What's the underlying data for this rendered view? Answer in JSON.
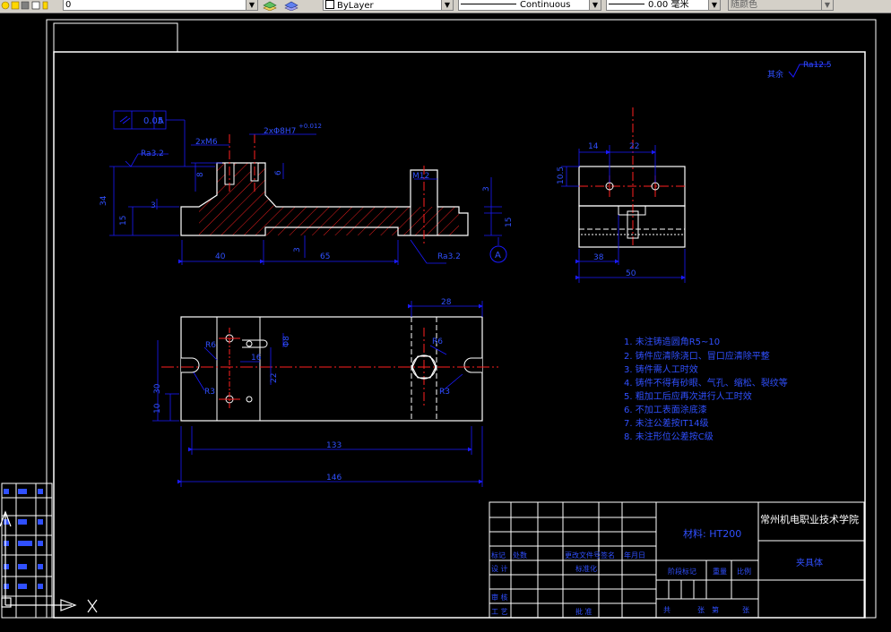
{
  "toolbar": {
    "layer_value": "0",
    "color_value": "ByLayer",
    "linetype_value": "Continuous",
    "lineweight_value": "0.00 毫米",
    "plotstyle_value": "随颜色"
  },
  "drawing": {
    "roughness_global": "其余",
    "roughness_global_value": "Ra12.5",
    "parallelism_tolerance": "0.05",
    "parallelism_datum": "A",
    "thread_label": "2xM6",
    "hole_label": "2xΦ8H7",
    "hole_tol": "+0.012",
    "ra_side": "Ra3.2",
    "ra_bottom": "Ra3.2",
    "m12": "M12",
    "datum_a": "A",
    "dim_34": "34",
    "dim_15_left": "15",
    "dim_3_left": "3",
    "dim_8": "8",
    "dim_6": "6",
    "dim_40": "40",
    "dim_65": "65",
    "dim_3_mid": "3",
    "dim_3_right": "3",
    "dim_15_right": "15",
    "dim_14": "14",
    "dim_22_side": "22",
    "dim_10_5": "10.5",
    "dim_38": "38",
    "dim_50": "50",
    "dim_28": "28",
    "dim_30": "30",
    "dim_10": "10",
    "dim_22_plan": "22",
    "dim_16": "16",
    "dim_phi8": "Φ8",
    "dim_r6_left": "R6",
    "dim_r3_left": "R3",
    "dim_r6_right": "R6",
    "dim_r3_right": "R3",
    "dim_133": "133",
    "dim_146": "146"
  },
  "notes": [
    "1. 未注铸造圆角R5~10",
    "2. 铸件应清除浇口、冒口应清除平整",
    "3. 铸件需人工时效",
    "4. 铸件不得有砂眼、气孔、缩松、裂纹等",
    "5. 粗加工后应再次进行人工时效",
    "6. 不加工表面涂底漆",
    "7. 未注公差按IT14级",
    "8. 未注形位公差按C级"
  ],
  "title_block": {
    "school": "常州机电职业技术学院",
    "material": "材料: HT200",
    "part_name": "夹具体",
    "row_design": "设 计",
    "row_standard": "标准化",
    "row_review": "审 核",
    "row_process": "工 艺",
    "row_approve": "批 准",
    "stage_mark": "阶段标记",
    "weight": "重量",
    "scale": "比例",
    "total": "共",
    "sheet": "张",
    "page": "第",
    "headers": [
      "标记",
      "处数",
      "更改文件号",
      "签名",
      "年月日"
    ]
  },
  "left_panel": {
    "items": [
      "",
      "",
      "",
      "",
      "",
      ""
    ]
  },
  "colors": {
    "geometry": "#ffffff",
    "dimension": "#1a1aff",
    "centerline": "#ff2020",
    "hatch": "#ff2020",
    "notes": "#3050ff"
  }
}
